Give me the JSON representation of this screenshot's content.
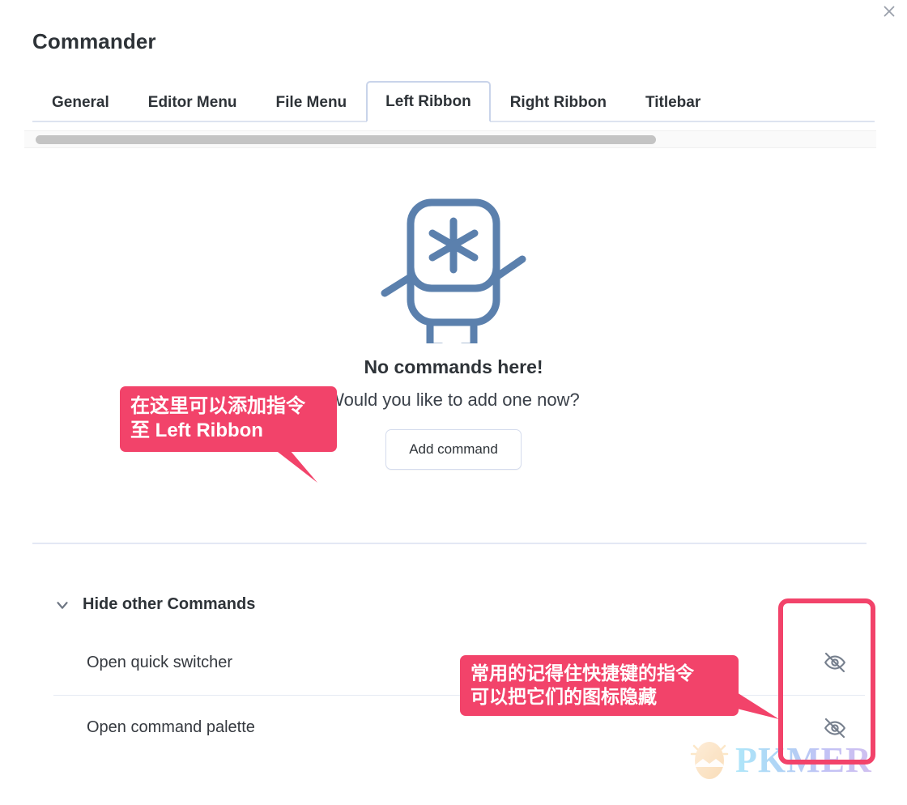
{
  "window": {
    "title": "Commander",
    "close_icon": "close-icon"
  },
  "tabs": [
    {
      "label": "General",
      "active": false
    },
    {
      "label": "Editor Menu",
      "active": false
    },
    {
      "label": "File Menu",
      "active": false
    },
    {
      "label": "Left Ribbon",
      "active": true
    },
    {
      "label": "Right Ribbon",
      "active": false
    },
    {
      "label": "Titlebar",
      "active": false
    }
  ],
  "scrollbar": {
    "orientation": "horizontal",
    "thumb_fraction": 0.73
  },
  "empty_state": {
    "illustration_icon": "robot-asterisk-icon",
    "title": "No commands here!",
    "subtitle": "Would you like to add one now?",
    "button_label": "Add command"
  },
  "hide_section": {
    "chevron_icon": "chevron-down-icon",
    "title": "Hide other Commands",
    "commands": [
      {
        "label": "Open quick switcher",
        "toggle_icon": "eye-off-icon"
      },
      {
        "label": "Open command palette",
        "toggle_icon": "eye-off-icon"
      }
    ]
  },
  "annotations": {
    "accent_color": "#f2436a",
    "callout_1": {
      "line1": "在这里可以添加指令",
      "line2": "至 Left Ribbon"
    },
    "callout_2": {
      "line1": "常用的记得住快捷键的指令",
      "line2": "可以把它们的图标隐藏"
    },
    "highlight_box": "eye-toggle-column-highlight"
  },
  "watermark": {
    "text": "PKMER",
    "logo_icon": "pkmer-egg-logo-icon"
  }
}
